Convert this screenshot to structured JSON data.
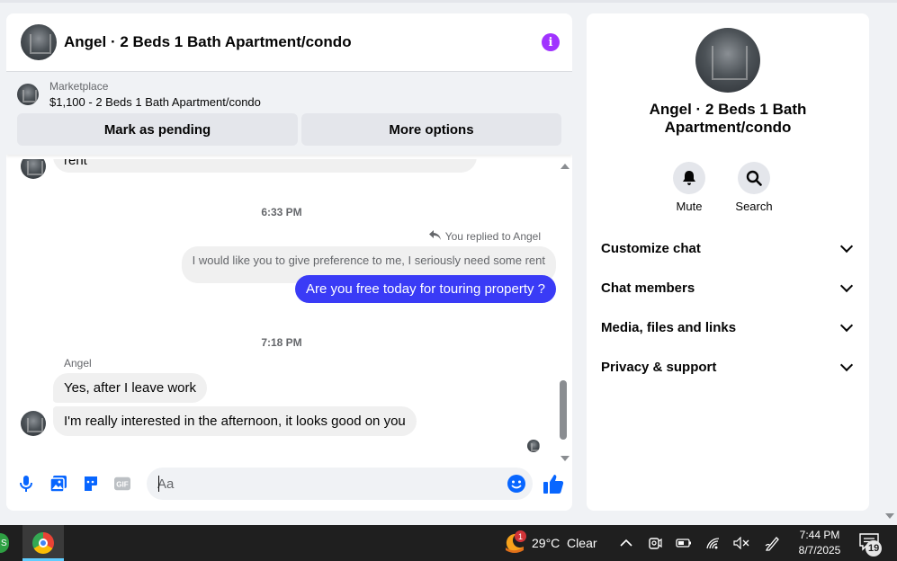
{
  "chat": {
    "header_title": "Angel · 2 Beds 1 Bath Apartment/condo",
    "marketplace_label": "Marketplace",
    "listing_title": "$1,100 - 2 Beds 1 Bath Apartment/condo",
    "mark_pending_label": "Mark as pending",
    "more_options_label": "More options",
    "partial_message": "rent",
    "time_1": "6:33 PM",
    "replied_label": "You replied to Angel",
    "quoted_message": "I would like you to give preference to me, I seriously need some rent",
    "outgoing_message": "Are you free today for touring property ?",
    "time_2": "7:18 PM",
    "sender_name": "Angel",
    "incoming_1": "Yes, after I leave work",
    "incoming_2": "I'm really interested in the afternoon, it looks good on you",
    "input_placeholder": "Aa",
    "input_value": ""
  },
  "side": {
    "name": "Angel · 2 Beds 1 Bath Apartment/condo",
    "mute_label": "Mute",
    "search_label": "Search",
    "items": [
      {
        "label": "Customize chat"
      },
      {
        "label": "Chat members"
      },
      {
        "label": "Media, files and links"
      },
      {
        "label": "Privacy & support"
      }
    ]
  },
  "taskbar": {
    "weather_badge": "1",
    "weather": "29°C  Clear",
    "time": "7:44 PM",
    "date": "8/7/2025",
    "notification_count": "19"
  },
  "colors": {
    "accent": "#0866ff",
    "outgoing_bubble": "#3a3bf6",
    "info": "#a033ff"
  },
  "icons": [
    "info-icon",
    "reply-icon",
    "microphone-icon",
    "gallery-icon",
    "sticker-icon",
    "gif-icon",
    "emoji-icon",
    "thumbs-up-icon",
    "bell-icon",
    "search-icon",
    "chevron-down-icon",
    "chrome-icon",
    "weather-icon",
    "chevron-up-icon",
    "wifi-icon",
    "battery-icon",
    "volume-muted-icon",
    "pen-icon",
    "notification-icon"
  ]
}
